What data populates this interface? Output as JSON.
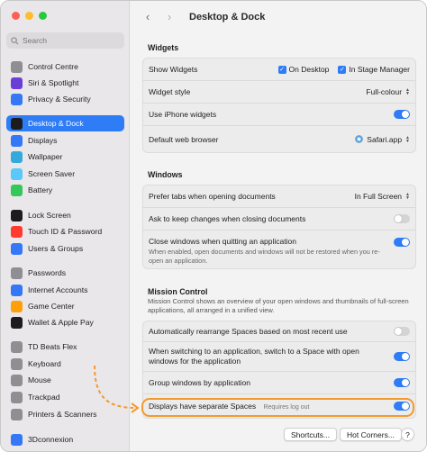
{
  "window": {
    "title": "Desktop & Dock"
  },
  "search": {
    "placeholder": "Search"
  },
  "sidebar": {
    "items": [
      {
        "label": "Control Centre",
        "icon": "control-centre-icon",
        "color": "#8e8e93"
      },
      {
        "label": "Siri & Spotlight",
        "icon": "siri-icon",
        "color": "#6a3fd8"
      },
      {
        "label": "Privacy & Security",
        "icon": "hand-icon",
        "color": "#3478f6"
      },
      {
        "label": "Desktop & Dock",
        "icon": "dock-icon",
        "color": "#1c1c1e",
        "selected": true
      },
      {
        "label": "Displays",
        "icon": "display-icon",
        "color": "#3478f6"
      },
      {
        "label": "Wallpaper",
        "icon": "wallpaper-icon",
        "color": "#34aadc"
      },
      {
        "label": "Screen Saver",
        "icon": "screensaver-icon",
        "color": "#5ac8fa"
      },
      {
        "label": "Battery",
        "icon": "battery-icon",
        "color": "#34c759"
      },
      {
        "label": "Lock Screen",
        "icon": "lock-icon",
        "color": "#1c1c1e"
      },
      {
        "label": "Touch ID & Password",
        "icon": "fingerprint-icon",
        "color": "#ff3b30"
      },
      {
        "label": "Users & Groups",
        "icon": "users-icon",
        "color": "#3478f6"
      },
      {
        "label": "Passwords",
        "icon": "key-icon",
        "color": "#8e8e93"
      },
      {
        "label": "Internet Accounts",
        "icon": "at-icon",
        "color": "#3478f6"
      },
      {
        "label": "Game Center",
        "icon": "game-center-icon",
        "color": "#ff9f0a"
      },
      {
        "label": "Wallet & Apple Pay",
        "icon": "wallet-icon",
        "color": "#1c1c1e"
      },
      {
        "label": "TD Beats Flex",
        "icon": "beats-icon",
        "color": "#8e8e93"
      },
      {
        "label": "Keyboard",
        "icon": "keyboard-icon",
        "color": "#8e8e93"
      },
      {
        "label": "Mouse",
        "icon": "mouse-icon",
        "color": "#8e8e93"
      },
      {
        "label": "Trackpad",
        "icon": "trackpad-icon",
        "color": "#8e8e93"
      },
      {
        "label": "Printers & Scanners",
        "icon": "printer-icon",
        "color": "#8e8e93"
      },
      {
        "label": "3Dconnexion",
        "icon": "3dconnexion-icon",
        "color": "#3478f6"
      }
    ]
  },
  "widgets": {
    "title": "Widgets",
    "show_widgets": {
      "label": "Show Widgets",
      "on_desktop": "On Desktop",
      "in_stage_manager": "In Stage Manager"
    },
    "widget_style": {
      "label": "Widget style",
      "value": "Full-colour"
    },
    "use_iphone": {
      "label": "Use iPhone widgets",
      "on": true
    },
    "default_browser": {
      "label": "Default web browser",
      "value": "Safari.app"
    }
  },
  "windows": {
    "title": "Windows",
    "prefer_tabs": {
      "label": "Prefer tabs when opening documents",
      "value": "In Full Screen"
    },
    "ask_keep": {
      "label": "Ask to keep changes when closing documents",
      "on": false
    },
    "close_windows": {
      "label": "Close windows when quitting an application",
      "on": true
    },
    "close_windows_desc": "When enabled, open documents and windows will not be restored when you re-open an application."
  },
  "mission_control": {
    "title": "Mission Control",
    "desc": "Mission Control shows an overview of your open windows and thumbnails of full-screen applications, all arranged in a unified view.",
    "auto_rearrange": {
      "label": "Automatically rearrange Spaces based on most recent use",
      "on": false
    },
    "switch_space": {
      "label": "When switching to an application, switch to a Space with open windows for the application",
      "on": true
    },
    "group_windows": {
      "label": "Group windows by application",
      "on": true
    },
    "separate_spaces": {
      "label": "Displays have separate Spaces",
      "sublabel": "Requires log out",
      "on": true
    }
  },
  "buttons": {
    "shortcuts": "Shortcuts...",
    "hot_corners": "Hot Corners...",
    "help": "?"
  },
  "accent": "#2e7cf6",
  "highlight_color": "#f29a2e"
}
